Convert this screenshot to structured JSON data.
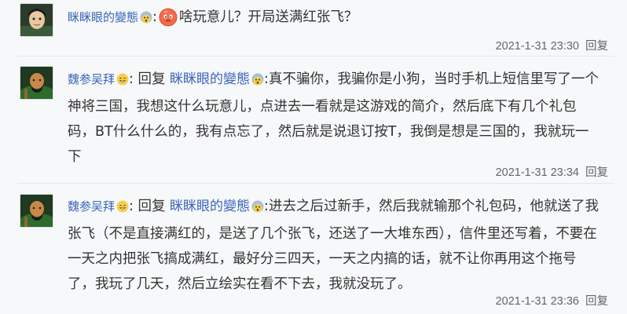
{
  "comments": [
    {
      "username": "眯眯眼的變態",
      "separator": ":",
      "text": "啥玩意儿？开局送满红张飞？",
      "timestamp": "2021-1-31 23:30",
      "reply_label": "回复"
    },
    {
      "username": "魏参吴拜",
      "reply_prefix": ": 回复 ",
      "reply_to": "眯眯眼的變態",
      "separator": ":",
      "text": "真不骗你，我骗你是小狗，当时手机上短信里写了一个神将三国，我想这什么玩意儿，点进去一看就是这游戏的简介，然后底下有几个礼包码，BT什么什么的，我有点忘了，然后就是说退订按T，我倒是想是三国的，我就玩一下",
      "timestamp": "2021-1-31 23:34",
      "reply_label": "回复"
    },
    {
      "username": "魏参吴拜",
      "reply_prefix": ": 回复 ",
      "reply_to": "眯眯眼的變態",
      "separator": ":",
      "text": "进去之后过新手，然后我就输那个礼包码，他就送了我张飞（不是直接满红的，是送了几个张飞，还送了一大堆东西），信件里还写着，不要在一天之内把张飞搞成满红，最好分三四天，一天之内搞的话，就不让你再用这个拖号了，我玩了几天，然后立绘实在看不下去，我就没玩了。",
      "timestamp": "2021-1-31 23:36",
      "reply_label": "回复"
    }
  ]
}
